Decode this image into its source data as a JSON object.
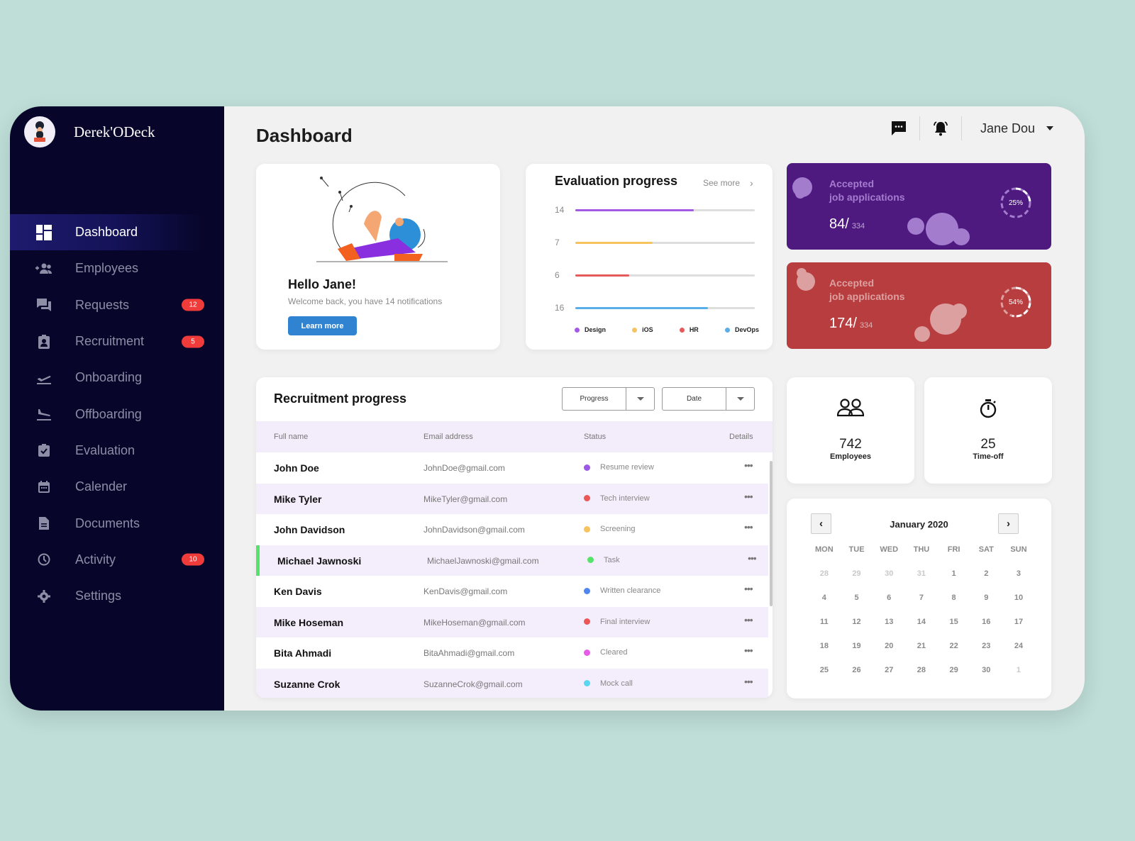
{
  "brand": {
    "name": "Derek'ODeck",
    "avatar_icon": "user-avatar"
  },
  "sidebar": {
    "items": [
      {
        "label": "Dashboard",
        "icon": "dashboard-icon",
        "active": true,
        "badge": null
      },
      {
        "label": "Employees",
        "icon": "add-group-icon",
        "badge": null
      },
      {
        "label": "Requests",
        "icon": "chat-bubbles-icon",
        "badge": "12"
      },
      {
        "label": "Recruitment",
        "icon": "id-badge-icon",
        "badge": "5"
      },
      {
        "label": "Onboarding",
        "icon": "plane-takeoff-icon",
        "badge": null
      },
      {
        "label": "Offboarding",
        "icon": "plane-landing-icon",
        "badge": null
      },
      {
        "label": "Evaluation",
        "icon": "clipboard-check-icon",
        "badge": null
      },
      {
        "label": "Calender",
        "icon": "calendar-icon",
        "badge": null
      },
      {
        "label": "Documents",
        "icon": "document-icon",
        "badge": null
      },
      {
        "label": "Activity",
        "icon": "clock-icon",
        "badge": "10"
      },
      {
        "label": "Settings",
        "icon": "gear-icon",
        "badge": null
      }
    ]
  },
  "header": {
    "title": "Dashboard",
    "user_name": "Jane Dou",
    "icons": [
      "message-icon",
      "bell-icon"
    ]
  },
  "hello_card": {
    "title": "Hello Jane!",
    "subtitle": "Welcome back, you have 14 notifications",
    "button": "Learn more"
  },
  "evaluation": {
    "title": "Evaluation progress",
    "see_more": "See more",
    "rows": [
      {
        "name": "Design",
        "value": "14",
        "progress": 0.66,
        "color": "#a259e6"
      },
      {
        "name": "iOS",
        "value": "7",
        "progress": 0.43,
        "color": "#f7c35f"
      },
      {
        "name": "HR",
        "value": "6",
        "progress": 0.3,
        "color": "#e55b5b"
      },
      {
        "name": "DevOps",
        "value": "16",
        "progress": 0.74,
        "color": "#5aaee8"
      }
    ]
  },
  "stats": [
    {
      "line1": "Accepted",
      "line2": "job applications",
      "value": "84/",
      "total": "334",
      "percent_label": "25%",
      "percent": 0.25,
      "color": "#4f1a80"
    },
    {
      "line1": "Accepted",
      "line2": "job applications",
      "value": "174/",
      "total": "334",
      "percent_label": "54%",
      "percent": 0.54,
      "color": "#b73d3f"
    }
  ],
  "recruitment": {
    "title": "Recruitment progress",
    "filters": [
      {
        "label": "Progress"
      },
      {
        "label": "Date"
      }
    ],
    "columns": [
      "Full name",
      "Email address",
      "Status",
      "Details"
    ],
    "rows": [
      {
        "name": "John Doe",
        "email": "JohnDoe@gmail.com",
        "status": "Resume review",
        "color": "#9b59e6"
      },
      {
        "name": "Mike Tyler",
        "email": "MikeTyler@gmail.com",
        "status": "Tech interview",
        "color": "#eb5757"
      },
      {
        "name": "John Davidson",
        "email": "JohnDavidson@gmail.com",
        "status": "Screening",
        "color": "#f7c35f"
      },
      {
        "name": "Michael Jawnoski",
        "email": "MichaelJawnoski@gmail.com",
        "status": "Task",
        "color": "#55e36a",
        "selected": true
      },
      {
        "name": "Ken Davis",
        "email": "KenDavis@gmail.com",
        "status": "Written clearance",
        "color": "#4f86f0"
      },
      {
        "name": "Mike Hoseman",
        "email": "MikeHoseman@gmail.com",
        "status": "Final interview",
        "color": "#eb5757"
      },
      {
        "name": "Bita Ahmadi",
        "email": "BitaAhmadi@gmail.com",
        "status": "Cleared",
        "color": "#e85ae8"
      },
      {
        "name": "Suzanne Crok",
        "email": "SuzanneCrok@gmail.com",
        "status": "Mock call",
        "color": "#5ad6f0"
      }
    ],
    "details_glyph": "•••"
  },
  "mini_stats": [
    {
      "value": "742",
      "label": "Employees",
      "icon": "people-icon"
    },
    {
      "value": "25",
      "label": "Time-off",
      "icon": "stopwatch-icon"
    }
  ],
  "calendar": {
    "month": "January 2020",
    "prev": "‹",
    "next": "›",
    "weekdays": [
      "MON",
      "TUE",
      "WED",
      "THU",
      "FRI",
      "SAT",
      "SUN"
    ],
    "weeks": [
      [
        {
          "d": "28",
          "m": true
        },
        {
          "d": "29",
          "m": true
        },
        {
          "d": "30",
          "m": true
        },
        {
          "d": "31",
          "m": true
        },
        {
          "d": "1"
        },
        {
          "d": "2"
        },
        {
          "d": "3"
        }
      ],
      [
        {
          "d": "4"
        },
        {
          "d": "5"
        },
        {
          "d": "6"
        },
        {
          "d": "7"
        },
        {
          "d": "8"
        },
        {
          "d": "9"
        },
        {
          "d": "10"
        }
      ],
      [
        {
          "d": "11"
        },
        {
          "d": "12"
        },
        {
          "d": "13"
        },
        {
          "d": "14"
        },
        {
          "d": "15"
        },
        {
          "d": "16"
        },
        {
          "d": "17"
        }
      ],
      [
        {
          "d": "18"
        },
        {
          "d": "19"
        },
        {
          "d": "20"
        },
        {
          "d": "21"
        },
        {
          "d": "22"
        },
        {
          "d": "23"
        },
        {
          "d": "24"
        }
      ],
      [
        {
          "d": "25"
        },
        {
          "d": "26"
        },
        {
          "d": "27"
        },
        {
          "d": "28"
        },
        {
          "d": "29"
        },
        {
          "d": "30"
        },
        {
          "d": "1",
          "m": true
        }
      ]
    ]
  }
}
